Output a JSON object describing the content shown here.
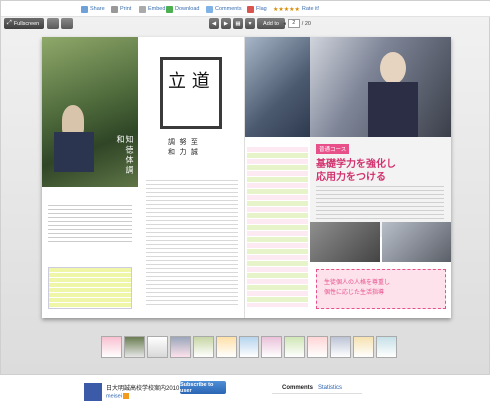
{
  "actions": {
    "share": "Share",
    "print": "Print",
    "embed": "Embed",
    "download": "Download",
    "comments": "Comments",
    "flag": "Flag",
    "rate": "Rate it!",
    "stars": 5
  },
  "toolbar": {
    "fullscreen": "Fullscreen",
    "add_to": "Add to",
    "page_current": "2",
    "page_total": "/ 20"
  },
  "book": {
    "p2_heading": "調  努  至\n和  力  誠",
    "p4_badge": "普通コース",
    "p4_title_line1": "基礎学力を強化し",
    "p4_title_line2": "応用力をつける",
    "p4_pink_line1": "生徒個人の人格を尊重し",
    "p4_pink_line2": "個性に応じた生活指導"
  },
  "footer": {
    "doc_title": "日大明誠高校学校案内2010",
    "author": "meisei",
    "subscribe": "Subscribe to user",
    "tab_comments": "Comments",
    "tab_statistics": "Statistics"
  },
  "colors": {
    "accent_blue": "#2b65b4",
    "pink": "#e8508a",
    "green": "#3fae49",
    "dark": "#3a3a3a"
  }
}
